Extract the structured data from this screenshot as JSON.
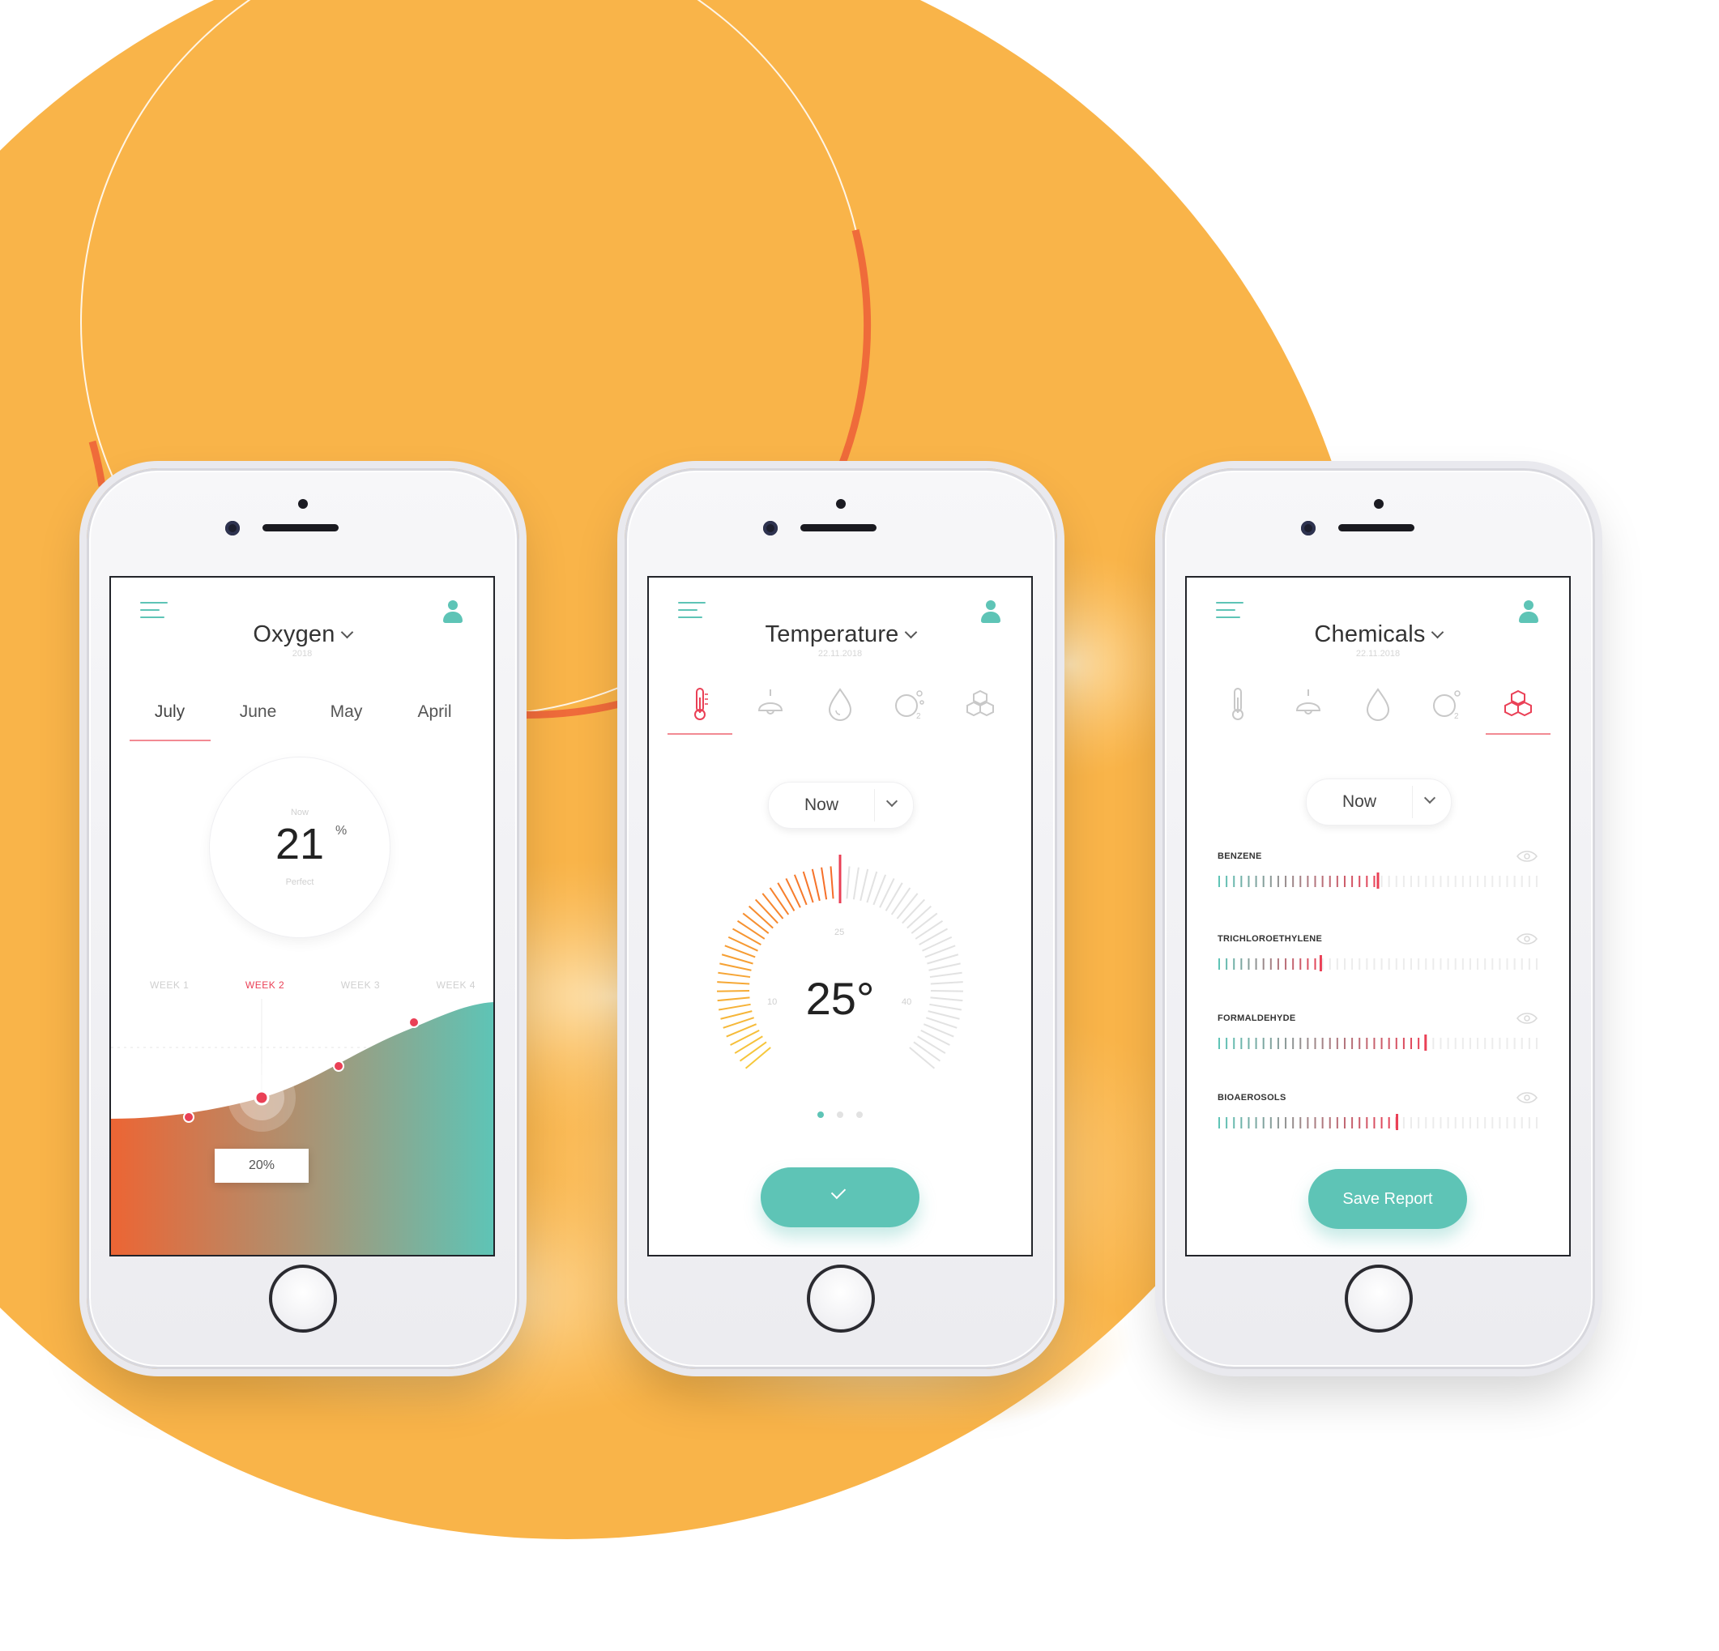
{
  "colors": {
    "accent": "#5ec4b6",
    "highlight": "#ea4056",
    "sun": "#f9b449",
    "ring": "#ef6b3a",
    "chart_gradient": [
      "#ec6534",
      "#5ec4b6"
    ]
  },
  "oxygen_screen": {
    "title": "Oxygen",
    "subtitle": "2018",
    "tabs": [
      "July",
      "June",
      "May",
      "April"
    ],
    "active_tab": "July",
    "gauge": {
      "caption_top": "Now",
      "value": "21",
      "unit": "%",
      "caption_bottom": "Perfect"
    },
    "weeks": [
      "WEEK 1",
      "WEEK 2",
      "WEEK 3",
      "WEEK 4"
    ],
    "active_week": "WEEK 2",
    "tooltip": "20%",
    "icons": {
      "menu": "menu-icon",
      "user": "user-icon",
      "dropdown": "chevron-down-icon"
    }
  },
  "temperature_screen": {
    "title": "Temperature",
    "subtitle": "22.11.2018",
    "sensor_tabs": [
      "thermometer-icon",
      "lamp-icon",
      "humidity-drop-icon",
      "co2-icon",
      "chemicals-icon"
    ],
    "active_sensor": "thermometer-icon",
    "select_label": "Now",
    "value": "25°",
    "dial_labels": {
      "low": "10",
      "mid": "25",
      "high": "40"
    },
    "dial_level": 0.5,
    "page_dots": 3,
    "active_dot": 1,
    "confirm_icon": "check-icon"
  },
  "chemicals_screen": {
    "title": "Chemicals",
    "subtitle": "22.11.2018",
    "sensor_tabs": [
      "thermometer-icon",
      "lamp-icon",
      "humidity-drop-icon",
      "co2-icon",
      "chemicals-icon"
    ],
    "active_sensor": "chemicals-icon",
    "select_label": "Now",
    "items": [
      {
        "name": "BENZENE",
        "level": 0.5
      },
      {
        "name": "TRICHLOROETHYLENE",
        "level": 0.32
      },
      {
        "name": "FORMALDEHYDE",
        "level": 0.65
      },
      {
        "name": "BIOAEROSOLS",
        "level": 0.56
      }
    ],
    "button_label": "Save Report",
    "row_icon": "eye-icon"
  }
}
